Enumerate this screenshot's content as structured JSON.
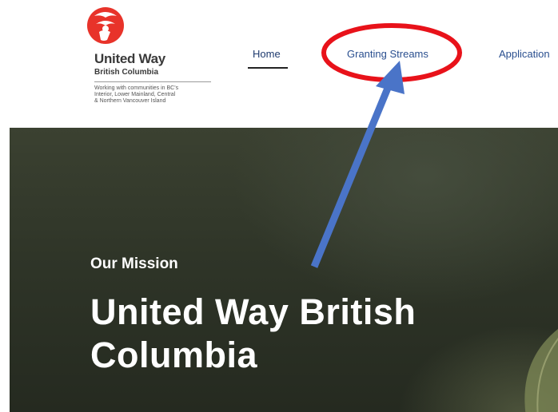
{
  "brand": {
    "name": "United Way",
    "region": "British Columbia",
    "description": "Working with communities in BC's\nInterior, Lower Mainland, Central\n& Northern Vancouver Island"
  },
  "nav": {
    "items": [
      {
        "label": "Home",
        "active": true
      },
      {
        "label": "Granting Streams",
        "active": false
      },
      {
        "label": "Application",
        "active": false
      }
    ]
  },
  "hero": {
    "eyebrow": "Our Mission",
    "title": "United Way British Columbia"
  },
  "colors": {
    "nav_text": "#2a4f8f",
    "logo_red": "#e8332a",
    "annotation_circle": "#e8121a",
    "annotation_arrow": "#4a74c8"
  }
}
